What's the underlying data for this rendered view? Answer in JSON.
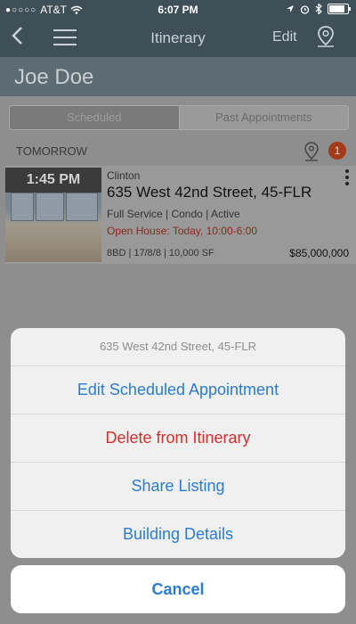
{
  "statusbar": {
    "carrier": "AT&T",
    "time": "6:07 PM"
  },
  "navbar": {
    "title": "Itinerary",
    "edit_label": "Edit"
  },
  "user": {
    "name": "Joe Doe"
  },
  "segments": [
    "Scheduled",
    "Past Appointments"
  ],
  "section": {
    "label": "TOMORROW",
    "badge": "1"
  },
  "listing": {
    "time": "1:45 PM",
    "area": "Clinton",
    "address": "635 West 42nd Street, 45-FLR",
    "meta": "Full Service | Condo | Active",
    "open_house": "Open House: Today, 10:00-6:00",
    "stats": "8BD | 17/8/8 | 10,000 SF",
    "price": "$85,000,000"
  },
  "action_sheet": {
    "title": "635 West 42nd Street, 45-FLR",
    "actions": [
      "Edit Scheduled Appointment",
      "Delete from Itinerary",
      "Share Listing",
      "Building Details"
    ],
    "cancel": "Cancel"
  },
  "colors": {
    "nav": "#3f4f57",
    "accent": "#2d7bd1",
    "destructive": "#d0312d"
  }
}
